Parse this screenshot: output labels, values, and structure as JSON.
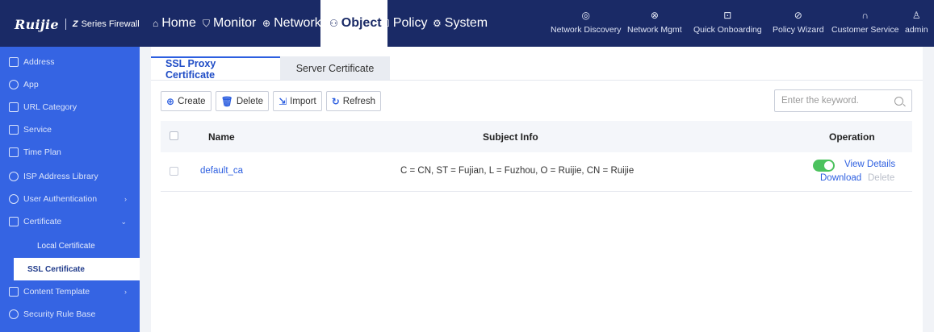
{
  "brand": {
    "logo": "Ruijie",
    "series_prefix": "Z",
    "series": "Series Firewall"
  },
  "nav": [
    {
      "label": "Home",
      "icon": "home-icon"
    },
    {
      "label": "Monitor",
      "icon": "shield-icon"
    },
    {
      "label": "Network",
      "icon": "globe-icon"
    },
    {
      "label": "Object",
      "icon": "object-icon",
      "active": true
    },
    {
      "label": "Policy",
      "icon": "policy-icon"
    },
    {
      "label": "System",
      "icon": "gear-icon"
    }
  ],
  "tools": [
    {
      "label": "Network Discovery",
      "icon": "wifi-icon"
    },
    {
      "label": "Network Mgmt",
      "icon": "network-mgmt-icon"
    },
    {
      "label": "Quick Onboarding",
      "icon": "onboarding-icon"
    },
    {
      "label": "Policy Wizard",
      "icon": "compass-icon"
    },
    {
      "label": "Customer Service",
      "icon": "headset-icon"
    },
    {
      "label": "admin",
      "icon": "user-icon"
    }
  ],
  "sidebar": {
    "items": [
      {
        "label": "Address",
        "icon": "address-icon"
      },
      {
        "label": "App",
        "icon": "app-icon"
      },
      {
        "label": "URL Category",
        "icon": "url-category-icon"
      },
      {
        "label": "Service",
        "icon": "service-icon"
      },
      {
        "label": "Time Plan",
        "icon": "calendar-icon"
      },
      {
        "label": "ISP Address Library",
        "icon": "isp-icon"
      },
      {
        "label": "User Authentication",
        "icon": "user-auth-icon"
      },
      {
        "label": "Certificate",
        "icon": "certificate-icon"
      },
      {
        "label": "Content Template",
        "icon": "content-template-icon"
      },
      {
        "label": "Security Rule Base",
        "icon": "security-rule-icon"
      }
    ],
    "sub_items": [
      {
        "label": "Local Certificate"
      },
      {
        "label": "SSL Certificate",
        "active": true
      }
    ]
  },
  "tabs": [
    {
      "label": "SSL Proxy Certificate",
      "active": true
    },
    {
      "label": "Server Certificate"
    }
  ],
  "toolbar": {
    "create": "Create",
    "delete": "Delete",
    "import": "Import",
    "refresh": "Refresh"
  },
  "search": {
    "placeholder": "Enter the keyword."
  },
  "table": {
    "columns": [
      "Name",
      "Subject Info",
      "Operation"
    ],
    "rows": [
      {
        "name": "default_ca",
        "subject": "C = CN, ST = Fujian, L = Fuzhou, O = Ruijie, CN = Ruijie",
        "enabled": true,
        "view": "View Details",
        "download": "Download",
        "delete": "Delete"
      }
    ]
  },
  "colors": {
    "topbar": "#1a2a66",
    "sidebar": "#3564e3",
    "accent": "#2d5fe0",
    "toggle_on": "#4cc25e"
  }
}
